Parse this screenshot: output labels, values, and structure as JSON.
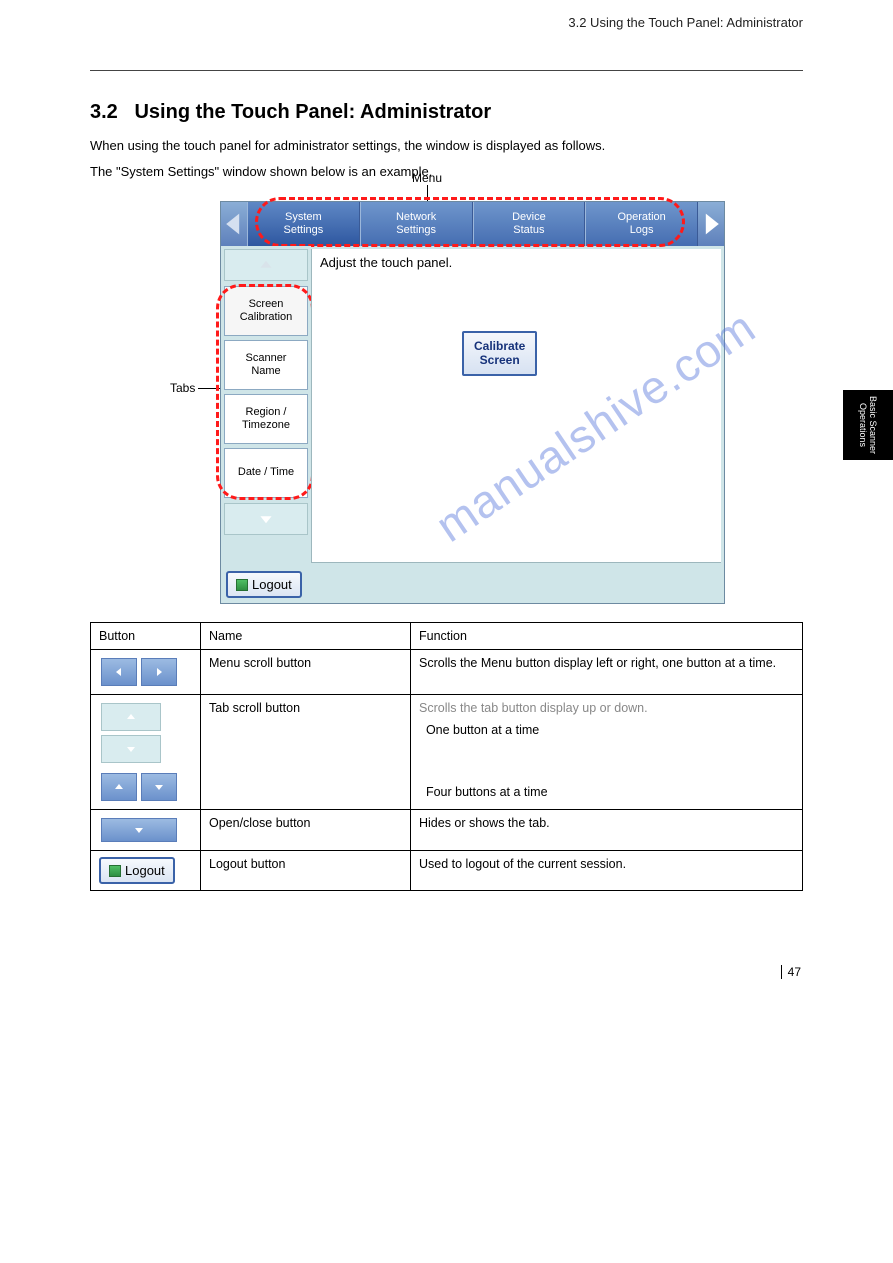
{
  "header": {
    "breadcrumb": "3.2 Using the Touch Panel: Administrator"
  },
  "side_tab": {
    "label": "Basic Scanner Operations"
  },
  "section": {
    "number": "3.2",
    "title": "Using the Touch Panel: Administrator",
    "p1": "When using the touch panel for administrator settings, the window is displayed as follows.",
    "p2": "The \"System Settings\" window shown below is an example."
  },
  "labels": {
    "menu": "Menu",
    "tabs": "Tabs"
  },
  "panel": {
    "menu_items": [
      "System\nSettings",
      "Network\nSettings",
      "Device\nStatus",
      "Operation\nLogs"
    ],
    "side_items": [
      "Screen\nCalibration",
      "Scanner\nName",
      "Region /\nTimezone",
      "Date / Time"
    ],
    "content_title": "Adjust the touch panel.",
    "calibrate": "Calibrate\nScreen",
    "logout": "Logout"
  },
  "watermark": "manualshive.com",
  "table": {
    "headers": [
      "Button",
      "Name",
      "Function"
    ],
    "rows": [
      {
        "name": "Menu scroll button",
        "func": "Scrolls the Menu button display left or right, one button at a time."
      },
      {
        "name": "Tab scroll button",
        "func_intro": "Scrolls the tab button display up or down.",
        "func_b1": "One button at a time",
        "func_b2": "Four buttons at a time"
      },
      {
        "name": "Open/close button",
        "func": "Hides or shows the tab."
      },
      {
        "name": "Logout button",
        "func": "Used to logout of the current session."
      }
    ]
  },
  "page_number": "47"
}
